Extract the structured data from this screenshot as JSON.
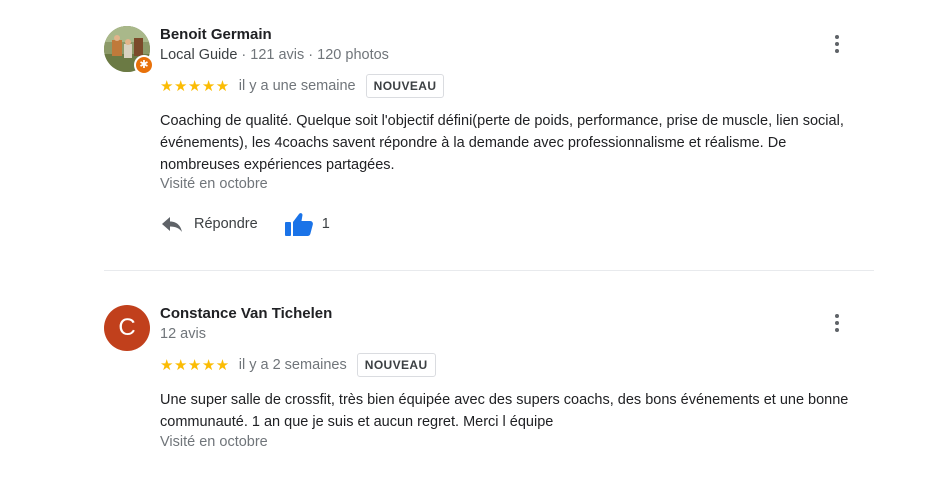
{
  "reviews": [
    {
      "author": "Benoit Germain",
      "guide_label": "Local Guide",
      "stats": " · 121 avis · 120 photos",
      "stars": "★★★★★",
      "time": "il y a une semaine",
      "badge": "NOUVEAU",
      "text": "Coaching de qualité. Quelque soit l'objectif défini(perte de poids, performance, prise de muscle, lien social, événements), les 4coachs savent répondre à la demande avec professionnalisme et réalisme. De nombreuses expériences partagées.",
      "visited": "Visité en octobre",
      "reply_label": "Répondre",
      "like_count": "1",
      "rating": 5
    },
    {
      "author": "Constance Van Tichelen",
      "avatar_letter": "C",
      "stats": "12 avis",
      "stars": "★★★★★",
      "time": "il y a 2 semaines",
      "badge": "NOUVEAU",
      "text": "Une super salle de crossfit, très bien équipée avec des supers coachs,  des bons événements et une bonne communauté. 1 an que je suis et aucun regret. Merci l équipe",
      "visited": "Visité en octobre",
      "rating": 5
    }
  ],
  "colors": {
    "star": "#fbbc04",
    "like_blue": "#1a73e8",
    "avatar_c": "#c1401c",
    "guide_badge": "#e8710a"
  },
  "icons": [
    "more-vert-icon",
    "reply-icon",
    "thumbs-up-icon",
    "local-guide-badge-icon"
  ]
}
